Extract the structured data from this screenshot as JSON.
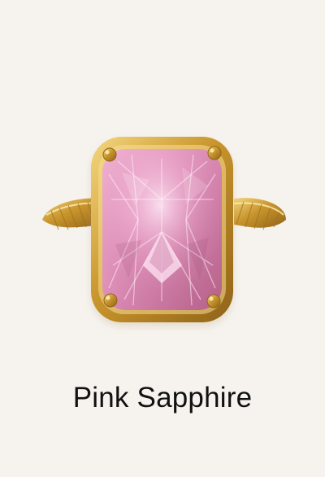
{
  "product": {
    "title": "Pink Sapphire",
    "image_icon": "ring-icon",
    "colors": {
      "background": "#f6f3ef",
      "gem_pink": "#e59bc4",
      "gold": "#d9ad4a",
      "text": "#111111"
    }
  }
}
